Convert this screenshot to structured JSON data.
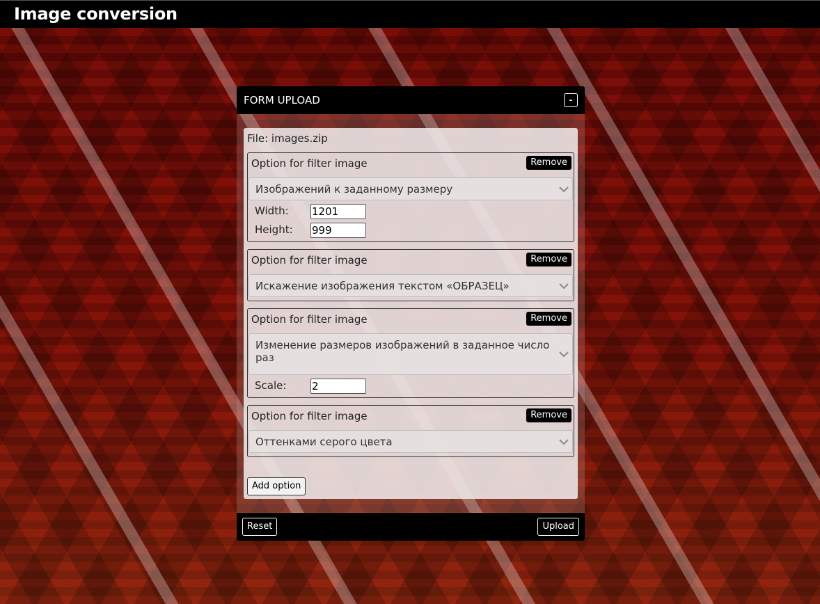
{
  "header": {
    "title": "Image conversion"
  },
  "panel": {
    "title": "FORM UPLOAD",
    "collapse_label": "-",
    "file_line": "File: images.zip",
    "options": [
      {
        "label": "Option for filter image",
        "remove_label": "Remove",
        "selected": "Изображений к заданному размеру",
        "fields": [
          {
            "label": "Width:",
            "value": "1201"
          },
          {
            "label": "Height:",
            "value": "999"
          }
        ]
      },
      {
        "label": "Option for filter image",
        "remove_label": "Remove",
        "selected": "Искажение изображения текстом «ОБРАЗЕЦ»",
        "fields": []
      },
      {
        "label": "Option for filter image",
        "remove_label": "Remove",
        "selected": "Изменение размеров изображений в заданное число раз",
        "fields": [
          {
            "label": "Scale:",
            "value": "2"
          }
        ]
      },
      {
        "label": "Option for filter image",
        "remove_label": "Remove",
        "selected": "Оттенками серого цвета",
        "fields": []
      }
    ],
    "add_option_label": "Add option",
    "reset_label": "Reset",
    "upload_label": "Upload"
  },
  "icons": {
    "select_arrow": "chevron-down-icon",
    "collapse": "minus-icon"
  },
  "colors": {
    "topbar": "#000000",
    "background": "#6a0a06",
    "panel_header": "#000000",
    "panel_body": "#eee8e8"
  }
}
